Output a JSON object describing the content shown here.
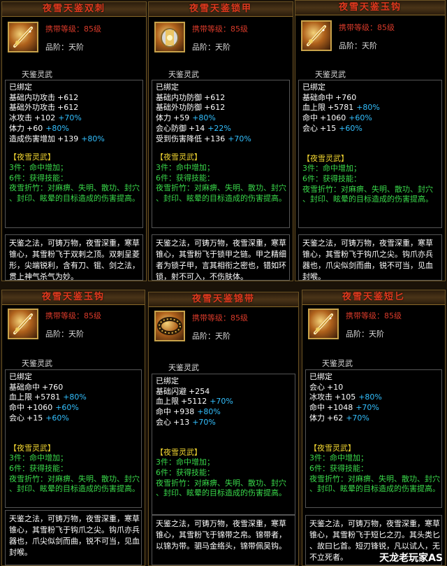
{
  "cards": [
    {
      "title": "夜雪天鉴双刺",
      "level": "携带等级：85级",
      "grade": "品阶：天阶",
      "section": "天鉴灵武",
      "bound": "已绑定",
      "stats": [
        {
          "name": "基础内功攻击",
          "value": "+612",
          "bonus": ""
        },
        {
          "name": "基础外功攻击",
          "value": "+612",
          "bonus": ""
        },
        {
          "name": "冰攻击",
          "value": "+102",
          "bonus": "+70%"
        },
        {
          "name": "体力",
          "value": "+60",
          "bonus": "+80%"
        },
        {
          "name": "造成伤害增加",
          "value": "+139",
          "bonus": "+80%"
        }
      ],
      "set_title": "【夜雪灵武】",
      "set3": "3件：命中增加；",
      "set6": "6件：获得技能：",
      "skill1": "夜雪折竹：对麻痹、失明、散功、封穴",
      "skill2": "、封印、眩晕的目标造成的伤害提高。",
      "desc": [
        "天鉴之法，可铸万物，夜雪深重，寒草",
        "锥心，其雪粉飞于双刺之顶。双刺呈菱",
        "形，尖端锐利，含有刀、锟、剑之法，",
        "贯上神气杀气为妙。"
      ]
    },
    {
      "title": "夜雪天鉴锁甲",
      "level": "携带等级：85级",
      "grade": "品阶：天阶",
      "section": "天鉴灵武",
      "bound": "已绑定",
      "stats": [
        {
          "name": "基础内功防御",
          "value": "+612",
          "bonus": ""
        },
        {
          "name": "基础外功防御",
          "value": "+612",
          "bonus": ""
        },
        {
          "name": "体力",
          "value": "+59",
          "bonus": "+80%"
        },
        {
          "name": "会心防御",
          "value": "+14",
          "bonus": "+22%"
        },
        {
          "name": "受到伤害降低",
          "value": "+136",
          "bonus": "+70%"
        }
      ],
      "set_title": "【夜雪灵武】",
      "set3": "3件：命中增加；",
      "set6": "6件：获得技能：",
      "skill1": "夜雪折竹：对麻痹、失明、散功、封穴",
      "skill2": "、封印、眩晕的目标造成的伤害提高。",
      "desc": [
        "天鉴之法，可铸万物，夜雪深重，寒草",
        "锥心，其雪粉飞于锁甲之链。甲之精细",
        "者为锁子甲，言其相衔之密也，错如环",
        "锁，射不可入，不伤肤体。"
      ]
    },
    {
      "title": "夜雪天鉴玉钩",
      "level": "携带等级：85级",
      "grade": "品阶：天阶",
      "section": "天鉴灵武",
      "bound": "已绑定",
      "stats": [
        {
          "name": "基础命中",
          "value": "+760",
          "bonus": ""
        },
        {
          "name": "血上限",
          "value": "+5781",
          "bonus": "+80%"
        },
        {
          "name": "命中",
          "value": "+1060",
          "bonus": "+60%"
        },
        {
          "name": "会心",
          "value": "+15",
          "bonus": "+60%"
        }
      ],
      "set_title": "【夜雪灵武】",
      "set3": "3件：命中增加；",
      "set6": "6件：获得技能：",
      "skill1": "夜雪折竹：对麻痹、失明、散功、封穴",
      "skill2": "、封印、眩晕的目标造成的伤害提高。",
      "desc": [
        "天鉴之法，可铸万物，夜雪深重，寒草",
        "锥心，其雪粉飞于钩爪之尖。钩爪亦兵",
        "器也，爪尖似剑而曲，锐不可当，见血",
        "封喉。"
      ]
    },
    {
      "title": "夜雪天鉴玉钩",
      "level": "携带等级：85级",
      "grade": "品阶：天阶",
      "section": "天鉴灵武",
      "bound": "已绑定",
      "stats": [
        {
          "name": "基础命中",
          "value": "+760",
          "bonus": ""
        },
        {
          "name": "血上限",
          "value": "+5781",
          "bonus": "+80%"
        },
        {
          "name": "命中",
          "value": "+1060",
          "bonus": "+60%"
        },
        {
          "name": "会心",
          "value": "+15",
          "bonus": "+60%"
        }
      ],
      "set_title": "【夜雪灵武】",
      "set3": "3件：命中增加；",
      "set6": "6件：获得技能：",
      "skill1": "夜雪折竹：对麻痹、失明、散功、封穴",
      "skill2": "、封印、眩晕的目标造成的伤害提高。",
      "desc": [
        "天鉴之法，可铸万物，夜雪深重，寒草",
        "锥心，其雪粉飞于钩爪之尖。钩爪亦兵",
        "器也，爪尖似剑而曲，锐不可当，见血",
        "封喉。"
      ]
    },
    {
      "title": "夜雪天鉴锦带",
      "level": "携带等级：85级",
      "grade": "品阶：天阶",
      "section": "天鉴灵武",
      "bound": "已绑定",
      "stats": [
        {
          "name": "基础闪避",
          "value": "+254",
          "bonus": ""
        },
        {
          "name": "血上限",
          "value": "+5112",
          "bonus": "+70%"
        },
        {
          "name": "命中",
          "value": "+938",
          "bonus": "+80%"
        },
        {
          "name": "会心",
          "value": "+13",
          "bonus": "+70%"
        }
      ],
      "set_title": "【夜雪灵武】",
      "set3": "3件：命中增加；",
      "set6": "6件：获得技能：",
      "skill1": "夜雪折竹：对麻痹、失明、散功、封穴",
      "skill2": "、封印、眩晕的目标造成的伤害提高。",
      "desc": [
        "天鉴之法，可铸万物，夜雪深重，寒草",
        "锥心，其雪粉飞于锦带之帛。锦带者，",
        "以锦为带。驷马金络头，锦带佩吴钩。"
      ]
    },
    {
      "title": "夜雪天鉴短匕",
      "level": "携带等级：85级",
      "grade": "品阶：天阶",
      "section": "天鉴灵武",
      "bound": "已绑定",
      "stats": [
        {
          "name": "会心",
          "value": "+10",
          "bonus": ""
        },
        {
          "name": "冰攻击",
          "value": "+105",
          "bonus": "+80%"
        },
        {
          "name": "命中",
          "value": "+1048",
          "bonus": "+70%"
        },
        {
          "name": "体力",
          "value": "+62",
          "bonus": "+70%"
        }
      ],
      "set_title": "【夜雪灵武】",
      "set3": "3件：命中增加；",
      "set6": "6件：获得技能：",
      "skill1": "夜雪折竹：对麻痹、失明、散功、封穴",
      "skill2": "、封印、眩晕的目标造成的伤害提高。",
      "desc": [
        "天鉴之法，可铸万物，夜雪深重，寒草",
        "锥心，其雪粉飞于短匕之刃。其头类匕",
        "、故曰匕首。短刃锋锐，凡以试人，无",
        "不立死者。"
      ]
    }
  ],
  "icons": [
    "dual-daggers-icon",
    "chain-armor-icon",
    "jade-hook-icon",
    "jade-hook-icon",
    "brocade-belt-icon",
    "short-dagger-icon"
  ],
  "watermark": "天龙老玩家AS"
}
